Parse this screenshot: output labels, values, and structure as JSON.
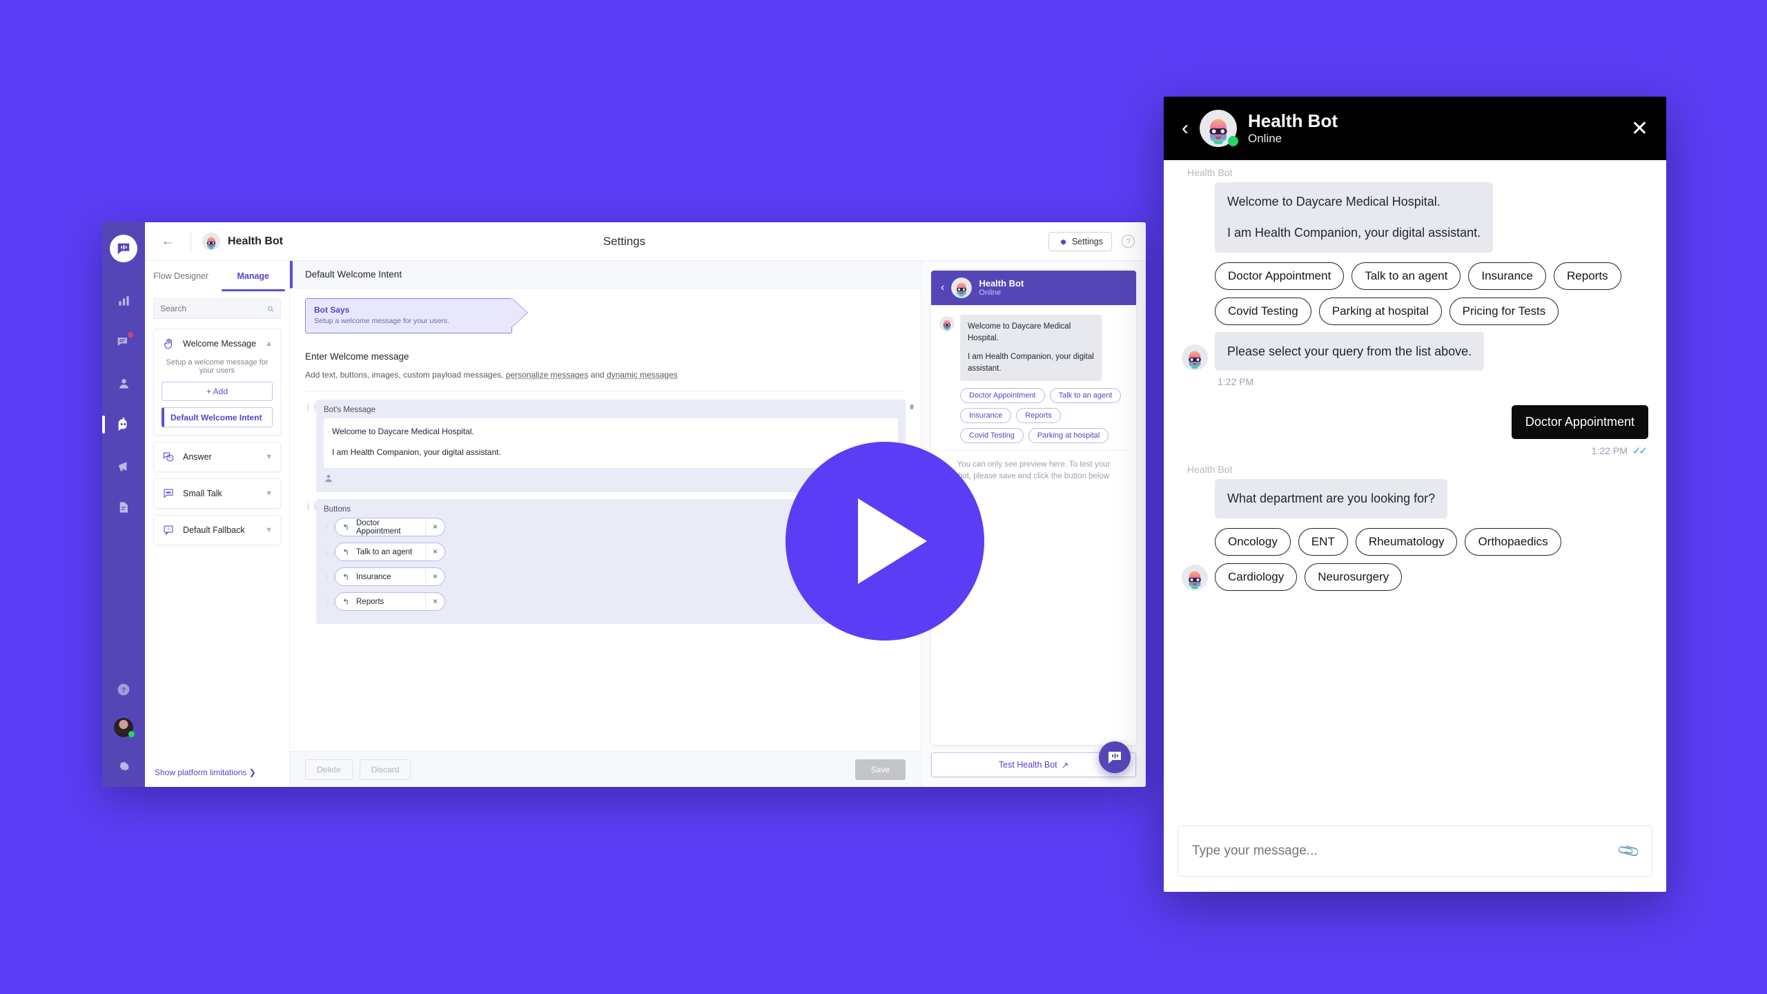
{
  "brand": {
    "purple": "#5b3df5",
    "rail": "#5546b8",
    "accent": "#4f46c9",
    "online": "#25d366",
    "alert": "#ff4d4d"
  },
  "app": {
    "topbar": {
      "back_icon": "back-arrow-icon",
      "bot_name": "Health Bot",
      "page_title": "Settings",
      "settings_label": "Settings",
      "settings_icon": "gear-icon",
      "help_icon": "help-icon"
    },
    "rail": {
      "logo_icon": "chat-logo-icon",
      "items": [
        {
          "name": "analytics",
          "icon": "bar-chart-icon",
          "active": false,
          "badge": false
        },
        {
          "name": "conversations",
          "icon": "chat-list-icon",
          "active": false,
          "badge": true
        },
        {
          "name": "contacts",
          "icon": "user-icon",
          "active": false,
          "badge": false
        },
        {
          "name": "bot-builder",
          "icon": "robot-icon",
          "active": true,
          "badge": false
        },
        {
          "name": "broadcast",
          "icon": "megaphone-icon",
          "active": false,
          "badge": false
        },
        {
          "name": "documents",
          "icon": "document-icon",
          "active": false,
          "badge": false
        }
      ],
      "bottom": [
        {
          "name": "help",
          "icon": "question-circle-icon"
        },
        {
          "name": "profile",
          "icon": "user-avatar"
        },
        {
          "name": "settings",
          "icon": "gear-icon"
        }
      ]
    },
    "left_panel": {
      "tabs": [
        {
          "label": "Flow Designer",
          "active": false
        },
        {
          "label": "Manage",
          "active": true
        }
      ],
      "search": {
        "placeholder": "Search",
        "value": "",
        "icon": "search-icon"
      },
      "sections": [
        {
          "title": "Welcome Message",
          "icon": "wave-hand-icon",
          "expanded": true,
          "subtitle": "Setup a welcome message for your users",
          "add_label": "+ Add",
          "items": [
            "Default Welcome Intent"
          ]
        },
        {
          "title": "Answer",
          "icon": "answer-bubble-icon",
          "expanded": false
        },
        {
          "title": "Small Talk",
          "icon": "dots-bubble-icon",
          "expanded": false
        },
        {
          "title": "Default Fallback",
          "icon": "question-bubble-icon",
          "expanded": false
        }
      ],
      "footer_link": "Show platform limitations"
    },
    "editor": {
      "header": "Default Welcome Intent",
      "node": {
        "title": "Bot Says",
        "subtitle": "Setup a welcome message for your users."
      },
      "section_title": "Enter Welcome message",
      "section_desc_prefix": "Add text, buttons, images, custom payload messages, ",
      "section_desc_link1": "personalize messages",
      "section_desc_mid": " and ",
      "section_desc_link2": "dynamic messages",
      "message_block": {
        "label": "Bot's Message",
        "lines": [
          "Welcome to Daycare Medical Hospital.",
          "I am Health Companion, your digital assistant."
        ],
        "footer_icon": "person-icon",
        "delete_icon": "trash-icon"
      },
      "buttons_block": {
        "label": "Buttons",
        "delete_icon": "trash-icon",
        "items": [
          {
            "label": "Doctor Appointment",
            "icon": "reply-arrow-icon",
            "remove": "×"
          },
          {
            "label": "Talk to an agent",
            "icon": "reply-arrow-icon",
            "remove": "×"
          },
          {
            "label": "Insurance",
            "icon": "reply-arrow-icon",
            "remove": "×"
          },
          {
            "label": "Reports",
            "icon": "reply-arrow-icon",
            "remove": "×"
          }
        ]
      },
      "footer": {
        "delete": "Delete",
        "discard": "Discard",
        "save": "Save"
      }
    },
    "preview": {
      "header": {
        "back_icon": "back-arrow-icon",
        "name": "Health Bot",
        "status": "Online"
      },
      "message": [
        "Welcome to Daycare Medical Hospital.",
        "I am Health Companion, your digital assistant."
      ],
      "chips": [
        "Doctor Appointment",
        "Talk to an agent",
        "Insurance",
        "Reports",
        "Covid Testing",
        "Parking at hospital"
      ],
      "note": "You can only see preview here. To test your bot, please save and click the button below",
      "test_button": "Test Health Bot",
      "test_button_icon": "external-link-icon",
      "fab_icon": "chat-logo-icon"
    }
  },
  "overlay": {
    "play_icon": "play-button-icon"
  },
  "widget": {
    "header": {
      "back_icon": "back-arrow-icon",
      "name": "Health Bot",
      "status": "Online",
      "close_icon": "close-icon"
    },
    "messages": [
      {
        "type": "bot",
        "sender": "Health Bot",
        "lines": [
          "Welcome to Daycare Medical Hospital.",
          "I am Health Companion, your digital assistant."
        ]
      },
      {
        "type": "chips",
        "items": [
          "Doctor Appointment",
          "Talk to an agent",
          "Insurance",
          "Reports",
          "Covid Testing",
          "Parking at hospital",
          "Pricing for Tests"
        ]
      },
      {
        "type": "bot",
        "lines": [
          "Please select your query from the list above."
        ],
        "time": "1:22 PM"
      },
      {
        "type": "user",
        "text": "Doctor Appointment",
        "time": "1:22 PM",
        "ticks": "✓✓"
      },
      {
        "type": "bot",
        "sender": "Health Bot",
        "lines": [
          "What department are you looking for?"
        ]
      },
      {
        "type": "chips",
        "items": [
          "Oncology",
          "ENT",
          "Rheumatology",
          "Orthopaedics",
          "Cardiology",
          "Neurosurgery"
        ]
      }
    ],
    "input": {
      "placeholder": "Type your message...",
      "value": "",
      "attach_icon": "paperclip-icon"
    }
  }
}
